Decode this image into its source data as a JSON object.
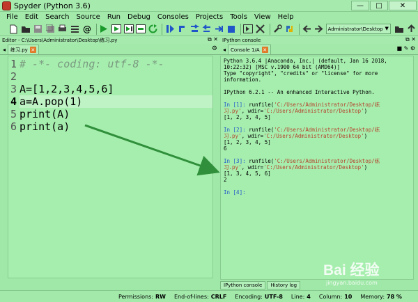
{
  "window": {
    "title": "Spyder (Python 3.6)"
  },
  "window_buttons": {
    "minimize": "—",
    "maximize": "□",
    "close": "✕"
  },
  "menu": [
    "File",
    "Edit",
    "Search",
    "Source",
    "Run",
    "Debug",
    "Consoles",
    "Projects",
    "Tools",
    "View",
    "Help"
  ],
  "toolbar": {
    "path_value": "Administrator\\Desktop"
  },
  "editor": {
    "header": "Editor - C:\\Users\\Administrator\\Desktop\\练习.py",
    "tab_label": "练习.py",
    "lines": [
      {
        "num": "1",
        "text": "# -*- coding: utf-8 -*-"
      },
      {
        "num": "2",
        "text": ""
      },
      {
        "num": "3",
        "text": "A=[1,2,3,4,5,6]"
      },
      {
        "num": "4",
        "text": "a=A.pop(1)"
      },
      {
        "num": "5",
        "text": "print(A)"
      },
      {
        "num": "6",
        "text": "print(a)"
      }
    ]
  },
  "console": {
    "header": "IPython console",
    "tab_label": "Console 1/A",
    "banner": [
      "Python 3.6.4 |Anaconda, Inc.| (default, Jan 16 2018,",
      "10:22:32) [MSC v.1900 64 bit (AMD64)]",
      "Type \"copyright\", \"credits\" or \"license\" for more",
      "information."
    ],
    "ipython_version": "IPython 6.2.1 -- An enhanced Interactive Python.",
    "runs": [
      {
        "prompt": "In [1]:",
        "cmd_a": " runfile(",
        "path1": "'C:/Users/Administrator/Desktop/练",
        "path2": "习.py'",
        "wdir_label": ", wdir=",
        "wdir": "'C:/Users/Administrator/Desktop'",
        "close": ")",
        "out": [
          "[1, 2, 3, 4, 5]"
        ]
      },
      {
        "prompt": "In [2]:",
        "cmd_a": " runfile(",
        "path1": "'C:/Users/Administrator/Desktop/练",
        "path2": "习.py'",
        "wdir_label": ", wdir=",
        "wdir": "'C:/Users/Administrator/Desktop'",
        "close": ")",
        "out": [
          "[1, 2, 3, 4, 5]",
          "6"
        ]
      },
      {
        "prompt": "In [3]:",
        "cmd_a": " runfile(",
        "path1": "'C:/Users/Administrator/Desktop/练",
        "path2": "习.py'",
        "wdir_label": ", wdir=",
        "wdir": "'C:/Users/Administrator/Desktop'",
        "close": ")",
        "out": [
          "[1, 3, 4, 5, 6]",
          "2"
        ]
      }
    ],
    "final_prompt": "In [4]:",
    "bottom_tabs": [
      "IPython console",
      "History log"
    ]
  },
  "status": {
    "permissions_label": "Permissions:",
    "permissions": "RW",
    "eol_label": "End-of-lines:",
    "eol": "CRLF",
    "encoding_label": "Encoding:",
    "encoding": "UTF-8",
    "line_label": "Line:",
    "line": "4",
    "column_label": "Column:",
    "column": "10",
    "memory_label": "Memory:",
    "memory": "78 %"
  },
  "watermark": {
    "main": "Bai 经验",
    "sub": "jingyan.baidu.com"
  },
  "colors": {
    "background": "#9fe8a7",
    "annotation_arrow": "#2f8f3a",
    "prompt": "#1f55c9",
    "string": "#b5422b"
  }
}
